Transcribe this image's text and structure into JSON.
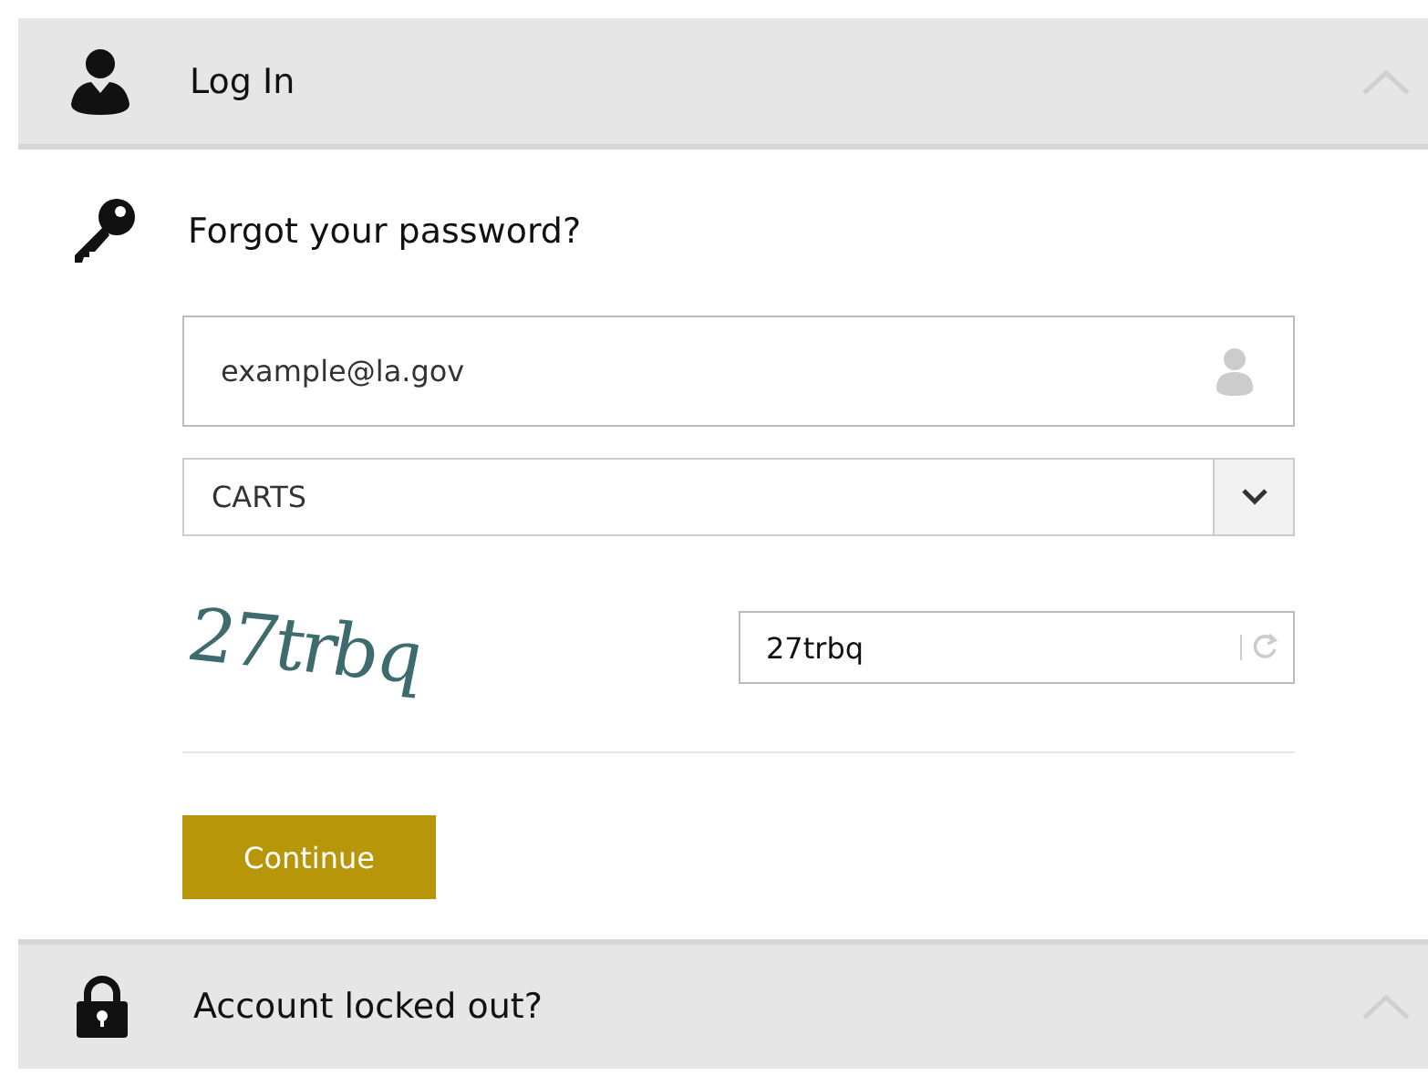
{
  "login_header": {
    "title": "Log In"
  },
  "forgot_password": {
    "title": "Forgot your password?",
    "email": {
      "value": "example@la.gov"
    },
    "system_select": {
      "value": "CARTS"
    },
    "captcha": {
      "text": "27trbq",
      "answer": "27trbq"
    },
    "continue_button": "Continue"
  },
  "locked_header": {
    "title": "Account locked out?"
  }
}
